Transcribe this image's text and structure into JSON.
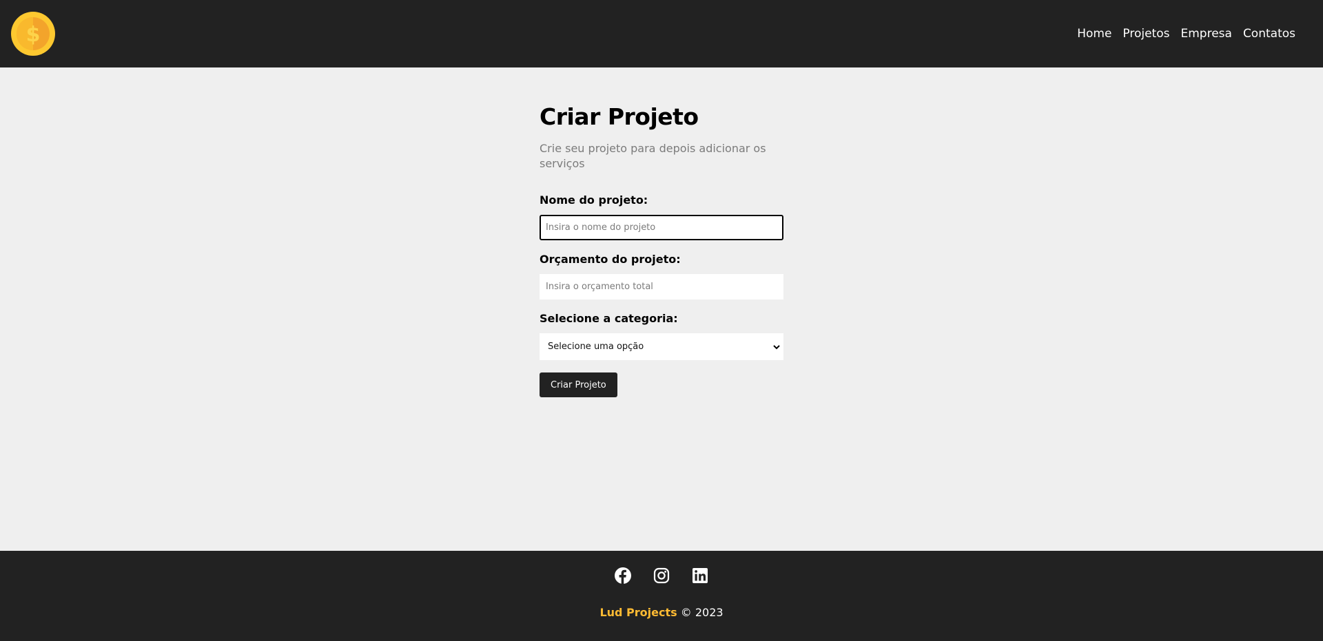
{
  "navbar": {
    "logo_icon": "coin-dollar-icon",
    "links": [
      {
        "label": "Home"
      },
      {
        "label": "Projetos"
      },
      {
        "label": "Empresa"
      },
      {
        "label": "Contatos"
      }
    ]
  },
  "main": {
    "title": "Criar Projeto",
    "subtitle": "Crie seu projeto para depois adicionar os serviços",
    "form": {
      "name_label": "Nome do projeto:",
      "name_placeholder": "Insira o nome do projeto",
      "name_value": "",
      "budget_label": "Orçamento do projeto:",
      "budget_placeholder": "Insira o orçamento total",
      "budget_value": "",
      "category_label": "Selecione a categoria:",
      "category_selected": "Selecione uma opção",
      "submit_label": "Criar Projeto"
    }
  },
  "footer": {
    "social": [
      {
        "icon": "facebook-icon"
      },
      {
        "icon": "instagram-icon"
      },
      {
        "icon": "linkedin-icon"
      }
    ],
    "brand": "Lud Projects",
    "copyright": "© 2023"
  },
  "colors": {
    "dark": "#222222",
    "background": "#efefef",
    "brand_accent": "#ffbb33"
  }
}
